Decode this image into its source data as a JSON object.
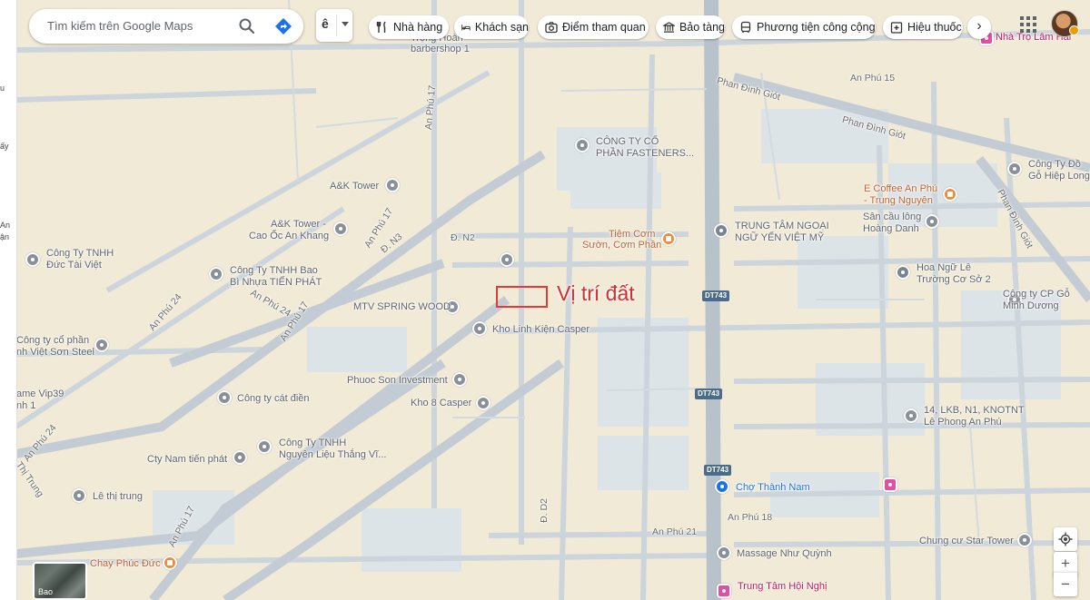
{
  "search": {
    "placeholder": "Tìm kiếm trên Google Maps"
  },
  "language": {
    "char": "ê"
  },
  "chips": [
    "Nhà hàng",
    "Khách sạn",
    "Điểm tham quan",
    "Bảo tàng",
    "Phương tiện công cộng",
    "Hiệu thuốc"
  ],
  "left_strip": [
    "u",
    "ấy",
    "An",
    "ận"
  ],
  "annotation": {
    "land_label": "Vị trí đất"
  },
  "route_shields": [
    "DT743",
    "DT743",
    "DT743"
  ],
  "places": {
    "nha_tro": "Nhà Trọ Lâm Hải",
    "trong_hoan": "Trọng Hoàn",
    "barbershop": "barbershop 1",
    "fasteners_1": "CÔNG TY CỔ",
    "fasteners_2": "PHẦN FASTENERS...",
    "dong_go_1": "Công Ty Đồ",
    "dong_go_2": "Gỗ Hiệp Long",
    "coffee_1": "E Coffee An Phú",
    "coffee_2": "- Trung Nguyên",
    "san_cau_1": "Sân cầu lông",
    "san_cau_2": "Hoàng Danh",
    "ak_tower": "A&K Tower",
    "ak_cao_oc_1": "A&K Tower -",
    "ak_cao_oc_2": "Cao Ốc An Khang",
    "tiem_com_1": "Tiệm Cơm",
    "tiem_com_2": "Sườn, Cơm Phần",
    "trung_tam_1": "TRUNG TÂM NGOẠI",
    "trung_tam_2": "NGỮ YẾN VIỆT MỸ",
    "cty_duc_tai_1": "Công Ty TNHH",
    "cty_duc_tai_2": "Đức Tài Việt",
    "bao_bi_1": "Công Ty TNHH Bao",
    "bao_bi_2": "Bì Nhựa TIẾN PHÁT",
    "hoa_ngu_1": "Hoa Ngữ Lê",
    "hoa_ngu_2": "Trường Cơ Sở 2",
    "minh_duong_1": "Công ty CP Gỗ",
    "minh_duong_2": "Minh Dương",
    "spring_wood": "MTV SPRING WOOD",
    "casper": "Kho Linh Kiện Casper",
    "viet_son_1": "Công ty cổ phần",
    "viet_son_2": "nh Việt Sơn Steel",
    "phuoc_son": "Phuoc Son Investment",
    "game_1": "ame Vip39",
    "game_2": "nh 1",
    "cat_dien": "Công ty cát điền",
    "kho8": "Kho 8 Casper",
    "lkb_1": "14, LKB, N1, KNOTNT",
    "lkb_2": "Lê Phong An Phú",
    "thang_vi_1": "Công Ty TNHH",
    "thang_vi_2": "Nguyên Liệu Thắng Vĩ...",
    "nam_tien": "Cty Nam tiến phát",
    "le_thi_trung": "Lê thị trung",
    "cho_thanh_nam": "Chợ Thành Nam",
    "massage": "Massage Như Quỳnh",
    "star_tower": "Chung cư Star Tower",
    "chay": "Chay Phúc Đức",
    "hoi_nghi": "Trung Tâm Hội Nghị"
  },
  "roads": {
    "an_phu_15": "An Phú 15",
    "phan_dinh_giot_1": "Phan Đình Giót",
    "phan_dinh_giot_2": "Phan Đình Giót",
    "phan_dinh_giot_3": "Phan Đình Giót",
    "an_phu_17_a": "An Phú 17",
    "an_phu_17_b": "An Phú 17",
    "an_phu_17_c": "An Phú 17",
    "an_phu_17_d": "An Phú 17",
    "dn3": "Đ. N3",
    "dn2": "Đ. N2",
    "an_phu_24_a": "An Phú 24",
    "an_phu_24_b": "An Phú 24",
    "an_phu_24_c": "An Phú 24",
    "d_d2": "Đ. D2",
    "an_phu_18": "An Phú 18",
    "an_phu_21": "An Phú 21",
    "thi_trung": "Thị Trung"
  },
  "controls": {
    "zoom_in": "+",
    "zoom_out": "−",
    "next": "›"
  },
  "layers": {
    "label": "Bao"
  }
}
